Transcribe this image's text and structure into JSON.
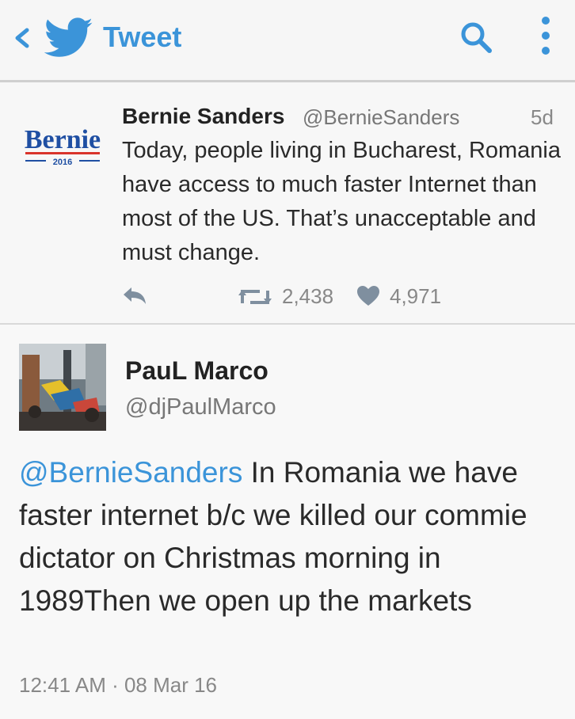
{
  "header": {
    "title": "Tweet",
    "accent": "#3b94d9"
  },
  "tweets": [
    {
      "avatar": {
        "logo_name": "Bernie",
        "logo_year": "2016"
      },
      "name": "Bernie Sanders",
      "handle": "@BernieSanders",
      "time": "5d",
      "text": "Today, people living in Bucharest, Romania have access to much faster Internet than most of the US. That’s unacceptable and must change.",
      "retweets": "2,438",
      "likes": "4,971"
    },
    {
      "name": "PauL Marco",
      "handle": "@djPaulMarco",
      "mention": "@BernieSanders",
      "text": " In Romania we have faster internet b/c we killed our commie dictator on Christmas morning in 1989Then we open up the markets",
      "timestamp": "12:41 AM · 08 Mar 16"
    }
  ],
  "icons": {
    "back": "chevron-left-icon",
    "brand": "twitter-bird-icon",
    "search": "search-icon",
    "more": "more-vertical-icon",
    "reply": "reply-icon",
    "retweet": "retweet-icon",
    "like": "heart-icon"
  }
}
